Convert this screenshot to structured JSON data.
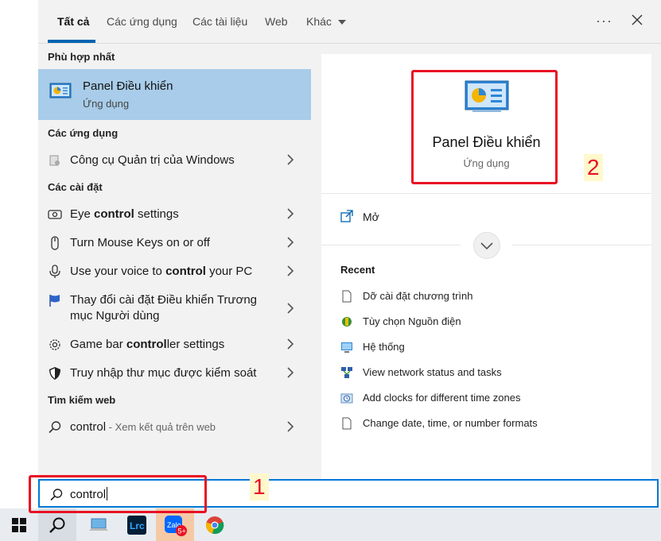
{
  "tabs": [
    {
      "label": "Tất cả"
    },
    {
      "label": "Các ứng dụng"
    },
    {
      "label": "Các tài liệu"
    },
    {
      "label": "Web"
    },
    {
      "label": "Khác"
    }
  ],
  "left": {
    "best_header": "Phù hợp nhất",
    "best": {
      "title": "Panel Điều khiển",
      "subtitle": "Ứng dụng"
    },
    "apps_header": "Các ứng dụng",
    "apps": [
      {
        "label": "Công cụ Quản trị của Windows"
      }
    ],
    "settings_header": "Các cài đặt",
    "settings": [
      {
        "pre": "Eye ",
        "bold": "control",
        "post": " settings"
      },
      {
        "pre": "Turn Mouse Keys on or off",
        "bold": "",
        "post": ""
      },
      {
        "pre": "Use your voice to ",
        "bold": "control",
        "post": " your PC"
      },
      {
        "pre": "Thay đổi cài đặt Điều khiển Trương",
        "line2": "mục Người dùng"
      },
      {
        "pre": "Game bar ",
        "bold": "control",
        "post": "ler settings"
      },
      {
        "pre": "Truy nhập thư mục được kiểm soát",
        "bold": "",
        "post": ""
      }
    ],
    "web_header": "Tìm kiếm web",
    "web": {
      "query": "control",
      "suffix": " - Xem kết quả trên web"
    }
  },
  "right": {
    "title": "Panel Điều khiển",
    "subtitle": "Ứng dụng",
    "open_label": "Mở",
    "recent_header": "Recent",
    "recent": [
      {
        "label": "Dỡ cài đặt chương trình"
      },
      {
        "label": "Tùy chọn Nguồn điện"
      },
      {
        "label": "Hệ thống"
      },
      {
        "label": "View network status and tasks"
      },
      {
        "label": "Add clocks for different time zones"
      },
      {
        "label": "Change date, time, or number formats"
      }
    ]
  },
  "search": {
    "value": "control"
  },
  "annotations": {
    "one": "1",
    "two": "2"
  },
  "colors": {
    "accent": "#0078d7",
    "selected": "#a8cce9",
    "annotation": "#e81123"
  }
}
